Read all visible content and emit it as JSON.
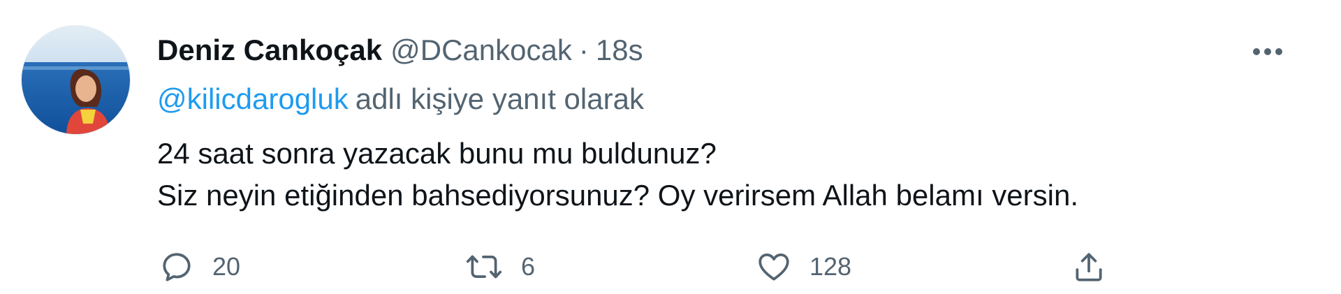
{
  "tweet": {
    "author": {
      "display_name": "Deniz Cankoçak",
      "handle": "@DCankocak",
      "separator": "·",
      "timestamp": "18s"
    },
    "reply_to": {
      "mention": "@kilicdarogluk",
      "suffix": "adlı kişiye yanıt olarak"
    },
    "text_lines": [
      "24 saat sonra yazacak bunu mu buldunuz?",
      "Siz neyin etiğinden bahsediyorsunuz? Oy verirsem Allah belamı versin."
    ],
    "actions": {
      "reply": {
        "icon": "reply-icon",
        "count": "20"
      },
      "retweet": {
        "icon": "retweet-icon",
        "count": "6"
      },
      "like": {
        "icon": "heart-icon",
        "count": "128"
      },
      "share": {
        "icon": "share-icon"
      }
    },
    "more_icon": "more-horizontal-icon"
  },
  "colors": {
    "text_primary": "#0f1419",
    "text_secondary": "#536471",
    "link": "#1d9bf0",
    "background": "#ffffff"
  }
}
